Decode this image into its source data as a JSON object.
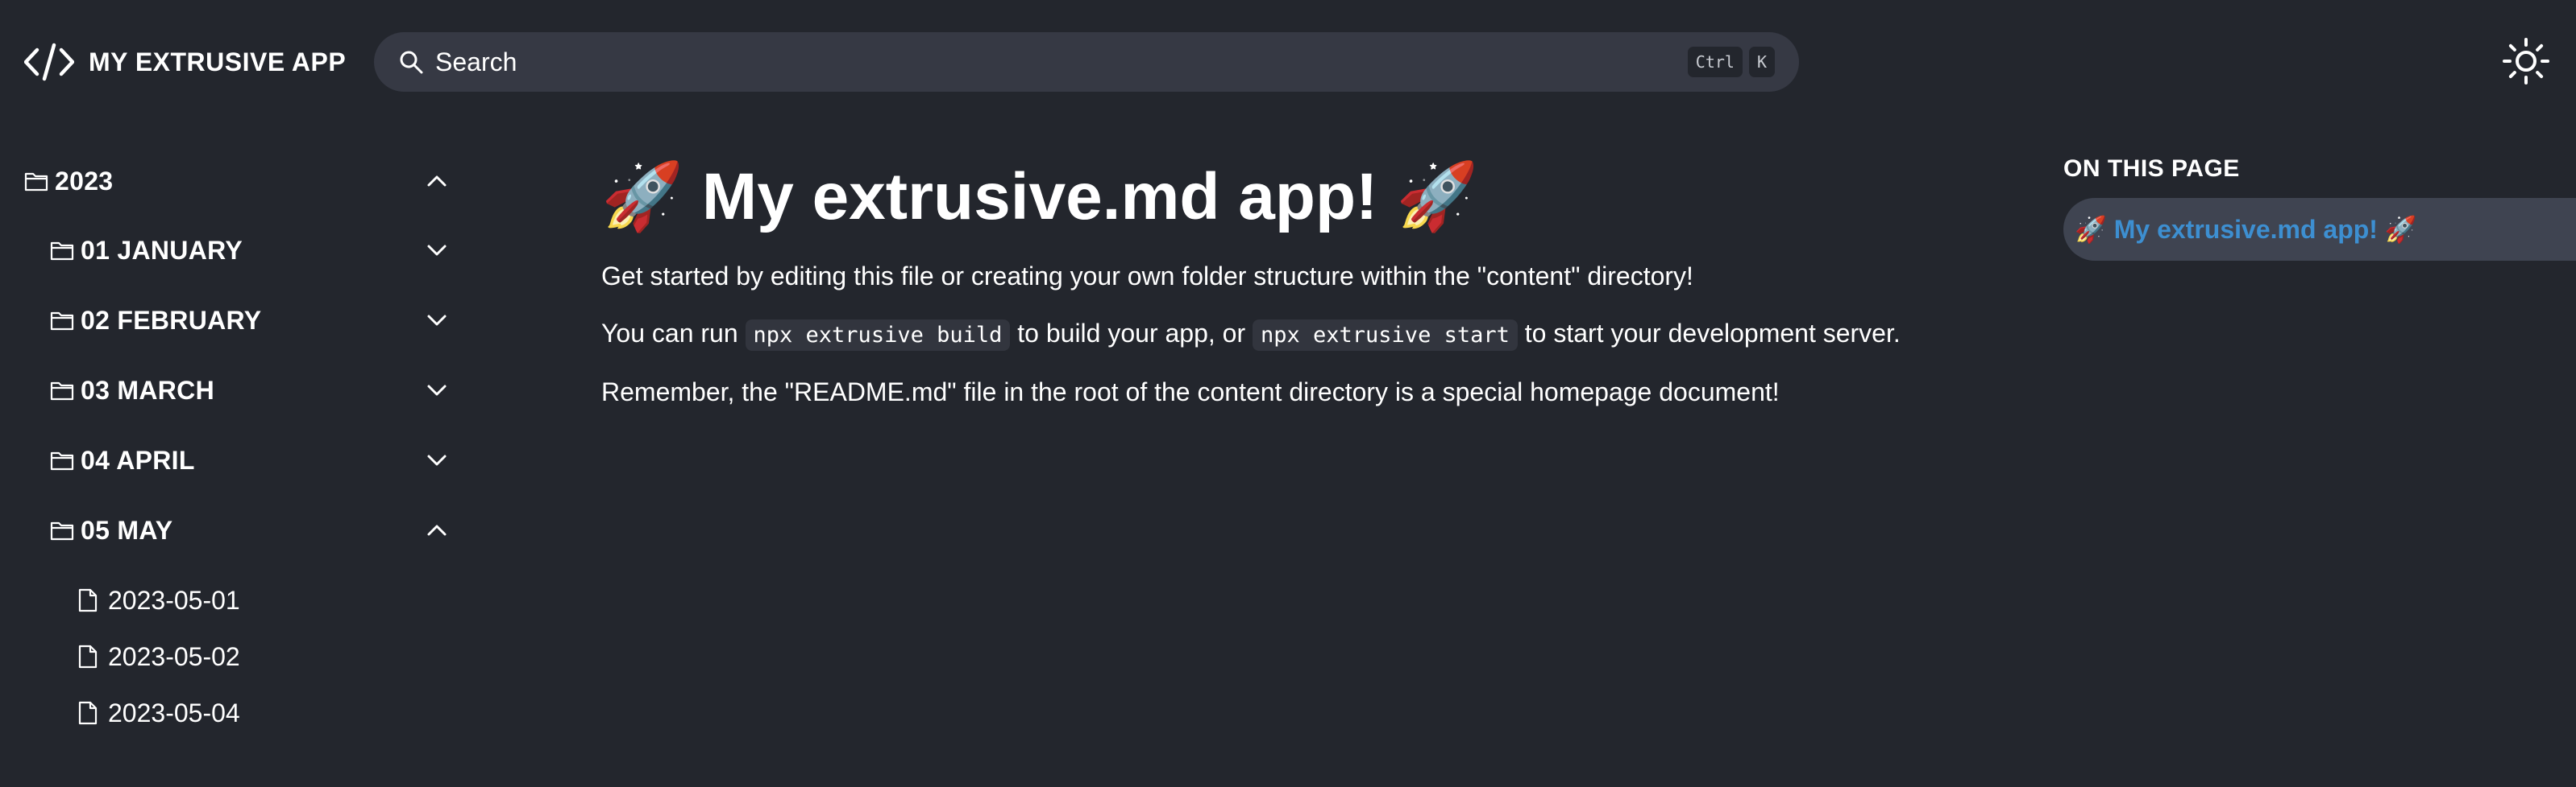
{
  "header": {
    "app_title": "MY EXTRUSIVE APP",
    "search_label": "Search",
    "shortcut_keys": [
      "Ctrl",
      "K"
    ],
    "theme_icon": "sun-icon"
  },
  "sidebar": {
    "year": {
      "label": "2023",
      "expanded": true
    },
    "months": [
      {
        "label": "01 JANUARY",
        "expanded": false
      },
      {
        "label": "02 FEBRUARY",
        "expanded": false
      },
      {
        "label": "03 MARCH",
        "expanded": false
      },
      {
        "label": "04 APRIL",
        "expanded": false
      },
      {
        "label": "05 MAY",
        "expanded": true
      }
    ],
    "files": [
      "2023-05-01",
      "2023-05-02",
      "2023-05-04"
    ]
  },
  "main": {
    "title": "🚀 My extrusive.md app! 🚀",
    "p1": "Get started by editing this file or creating your own folder structure within the \"content\" directory!",
    "p2_before": "You can run ",
    "p2_code1": "npx extrusive build",
    "p2_middle": " to build your app, or ",
    "p2_code2": "npx extrusive start",
    "p2_after": " to start your development server.",
    "p3": "Remember, the \"README.md\" file in the root of the content directory is a special homepage document!"
  },
  "toc": {
    "heading": "ON THIS PAGE",
    "items": [
      "🚀 My extrusive.md app! 🚀"
    ]
  },
  "colors": {
    "background": "#23262d",
    "search_background": "#363944",
    "toc_active_background": "#3f4451",
    "toc_link": "#3d8fd1",
    "text": "#ffffff"
  }
}
